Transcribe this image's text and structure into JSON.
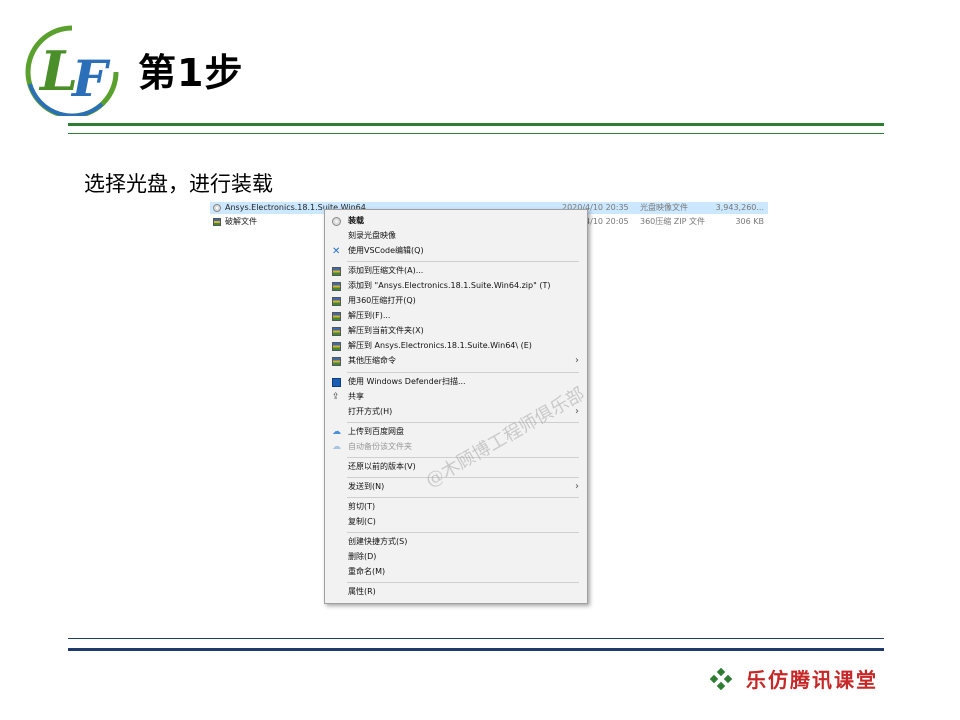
{
  "slide": {
    "title": "第1步",
    "instruction": "选择光盘，进行装载",
    "logo_text": "LF",
    "watermark": "@木顾博工程师俱乐部",
    "footer_brand": "乐仿腾讯课堂"
  },
  "colors": {
    "green_rule": "#2e7d32",
    "navy_rule": "#1f3b6e",
    "brand_red": "#c62828",
    "selection": "#cce8ff"
  },
  "files": [
    {
      "name": "Ansys.Electronics.18.1.Suite.Win64",
      "date": "2020/4/10 20:35",
      "type": "光盘映像文件",
      "size": "3,943,260...",
      "icon": "disc-image-icon",
      "selected": true
    },
    {
      "name": "破解文件",
      "date": "2020/4/10 20:05",
      "type": "360压缩 ZIP 文件",
      "size": "306 KB",
      "icon": "zip-archive-icon",
      "selected": false
    }
  ],
  "menu": {
    "mount": "装载",
    "burn": "刻录光盘映像",
    "vscode": "使用VSCode编辑(Q)",
    "add_archive": "添加到压缩文件(A)...",
    "add_named": "添加到 \"Ansys.Electronics.18.1.Suite.Win64.zip\" (T)",
    "open_360": "用360压缩打开(Q)",
    "extract_to": "解压到(F)...",
    "extract_here": "解压到当前文件夹(X)",
    "extract_folder": "解压到 Ansys.Electronics.18.1.Suite.Win64\\ (E)",
    "other_compress": "其他压缩命令",
    "defender": "使用 Windows Defender扫描...",
    "share": "共享",
    "open_with": "打开方式(H)",
    "upload_baidu": "上传到百度网盘",
    "auto_backup": "自动备份该文件夹",
    "restore": "还原以前的版本(V)",
    "send_to": "发送到(N)",
    "cut": "剪切(T)",
    "copy": "复制(C)",
    "shortcut": "创建快捷方式(S)",
    "delete": "删除(D)",
    "rename": "重命名(M)",
    "properties": "属性(R)"
  }
}
